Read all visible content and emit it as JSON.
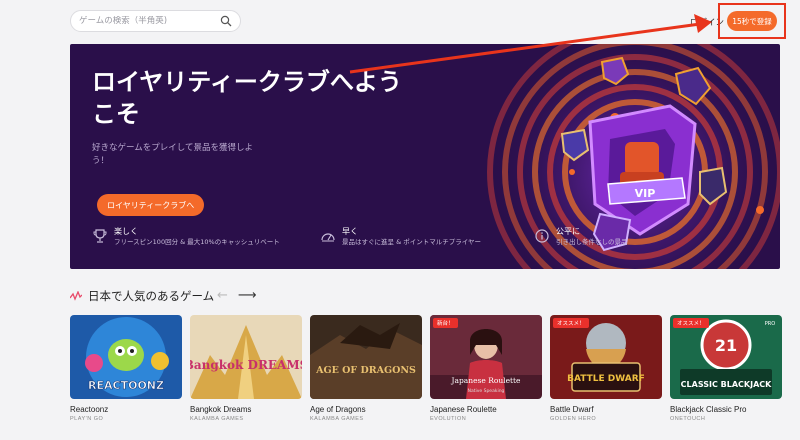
{
  "header": {
    "search_placeholder": "ゲームの検索（半角英)",
    "login_label": "ログイン",
    "register_label": "15秒で登録"
  },
  "hero": {
    "title": "ロイヤリティークラブへようこそ",
    "subtitle": "好きなゲームをプレイして景品を獲得しよう！",
    "button_label": "ロイヤリティークラブへ",
    "vip_label": "VIP",
    "features": [
      {
        "title": "楽しく",
        "desc": "フリースピン100回分 & 最大10%のキャッシュリベート"
      },
      {
        "title": "早く",
        "desc": "景品はすぐに進呈 & ポイントマルチプライヤー"
      },
      {
        "title": "公平に",
        "desc": "引き出し条件なしの景品"
      }
    ]
  },
  "section": {
    "title": "日本で人気のあるゲーム",
    "prev_label": "←",
    "next_label": "⟶"
  },
  "games": [
    {
      "name": "Reactoonz",
      "provider": "PLAY'N GO",
      "art_text": "REACTOONZ",
      "badge": ""
    },
    {
      "name": "Bangkok Dreams",
      "provider": "KALAMBA GAMES",
      "art_text": "Bangkok DREAMS",
      "badge": ""
    },
    {
      "name": "Age of Dragons",
      "provider": "KALAMBA GAMES",
      "art_text": "AGE OF DRAGONS",
      "badge": ""
    },
    {
      "name": "Japanese Roulette",
      "provider": "EVOLUTION",
      "art_text": "Japanese Roulette",
      "art_sub": "Native Speaking",
      "badge": "新台！"
    },
    {
      "name": "Battle Dwarf",
      "provider": "GOLDEN HERO",
      "art_text": "BATTLE DWARF",
      "badge": "オススメ！"
    },
    {
      "name": "Blackjack Classic Pro",
      "provider": "ONETOUCH",
      "art_text": "CLASSIC BLACKJACK",
      "badge": "オススメ！",
      "art_num": "21",
      "art_tag": "PRO"
    }
  ],
  "colors": {
    "accent": "#f46a2a",
    "hero_bg": "#2a0f4a",
    "highlight": "#e8341c"
  }
}
